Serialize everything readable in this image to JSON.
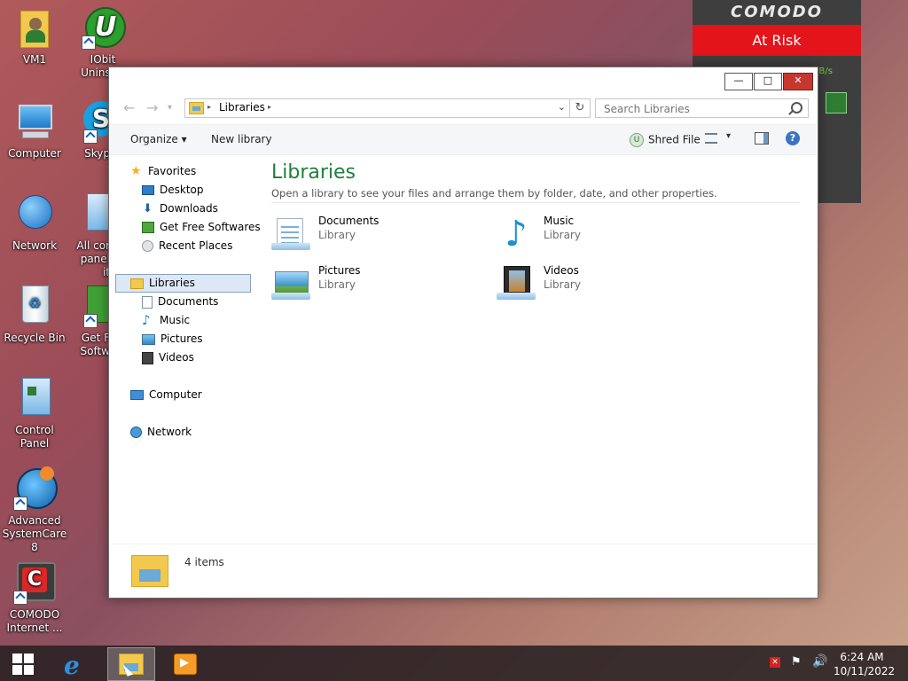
{
  "desktop": {
    "icons": [
      {
        "label": "VM1"
      },
      {
        "label": "IObit Uninst..."
      },
      {
        "label": "Computer"
      },
      {
        "label": "Skyp"
      },
      {
        "label": "Network"
      },
      {
        "label": "All cor panel it"
      },
      {
        "label": "Recycle Bin"
      },
      {
        "label": "Get F Softw"
      },
      {
        "label": "Control Panel"
      },
      {
        "label": "Advanced SystemCare 8"
      },
      {
        "label": "COMODO Internet ..."
      }
    ]
  },
  "comodo_widget": {
    "brand": "COMODO",
    "status": "At Risk",
    "speed_unit": "B/s",
    "status_color": "#e3141a"
  },
  "window": {
    "controls": {
      "minimize": "—",
      "maximize": "□",
      "close": "✕"
    },
    "address": {
      "crumb": "Libraries",
      "separator": "▸"
    },
    "search": {
      "placeholder": "Search Libraries"
    },
    "toolbar": {
      "organize": "Organize ▾",
      "new_library": "New library",
      "shred_file": "Shred File",
      "views_dropdown": "▾",
      "help": "?"
    },
    "nav": {
      "favorites": "Favorites",
      "desktop": "Desktop",
      "downloads": "Downloads",
      "get_free_softwares": "Get Free Softwares",
      "recent_places": "Recent Places",
      "libraries": "Libraries",
      "documents": "Documents",
      "music": "Music",
      "pictures": "Pictures",
      "videos": "Videos",
      "computer": "Computer",
      "network": "Network"
    },
    "content": {
      "title": "Libraries",
      "subtitle": "Open a library to see your files and arrange them by folder, date, and other properties.",
      "libraries": [
        {
          "name": "Documents",
          "type": "Library",
          "icon": "documents-library-icon"
        },
        {
          "name": "Music",
          "type": "Library",
          "icon": "music-library-icon"
        },
        {
          "name": "Pictures",
          "type": "Library",
          "icon": "pictures-library-icon"
        },
        {
          "name": "Videos",
          "type": "Library",
          "icon": "videos-library-icon"
        }
      ]
    },
    "details": {
      "item_count": "4 items"
    }
  },
  "taskbar": {
    "clock": {
      "time": "6:24 AM",
      "date": "10/11/2022"
    }
  },
  "colors": {
    "library_title": "#1e7f3a",
    "close_button": "#c7372f",
    "selection": "#dce8f5"
  }
}
